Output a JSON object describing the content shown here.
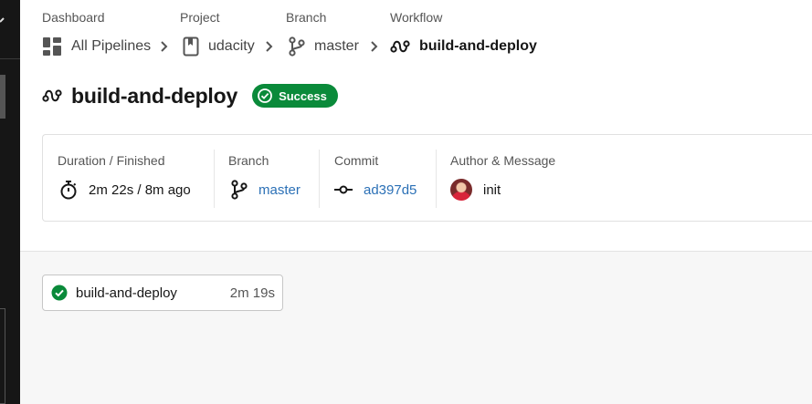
{
  "breadcrumbs": [
    {
      "label": "Dashboard",
      "value": "All Pipelines",
      "icon": "dashboard-icon"
    },
    {
      "label": "Project",
      "value": "udacity",
      "icon": "project-icon"
    },
    {
      "label": "Branch",
      "value": "master",
      "icon": "branch-icon"
    },
    {
      "label": "Workflow",
      "value": "build-and-deploy",
      "icon": "workflow-icon"
    }
  ],
  "workflow": {
    "title": "build-and-deploy",
    "status": "Success",
    "status_color": "#0a8a3a"
  },
  "details": {
    "duration_label": "Duration / Finished",
    "duration_value": "2m 22s / 8m ago",
    "branch_label": "Branch",
    "branch_value": "master",
    "commit_label": "Commit",
    "commit_value": "ad397d5",
    "author_label": "Author & Message",
    "author_message": "init"
  },
  "jobs": [
    {
      "name": "build-and-deploy",
      "duration": "2m 19s",
      "status": "success"
    }
  ],
  "colors": {
    "link": "#2b70b6",
    "success": "#0a8a3a",
    "sidebar": "#161616"
  }
}
